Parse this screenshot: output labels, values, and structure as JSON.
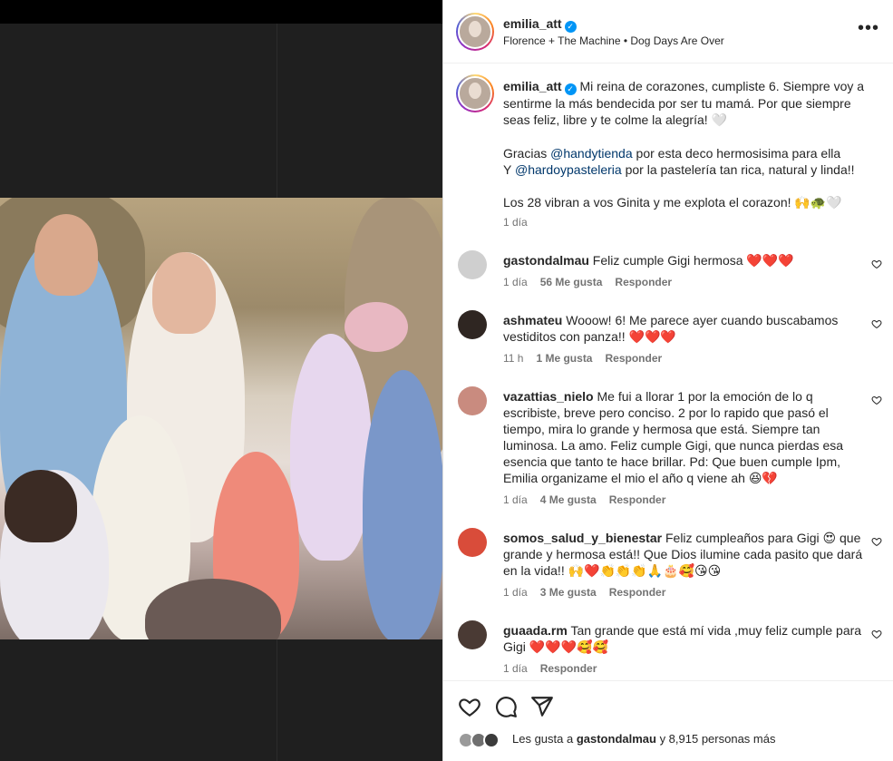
{
  "post": {
    "username": "emilia_att",
    "audio": "Florence + The Machine • Dog Days Are Over",
    "more_icon": "more-horizontal-icon"
  },
  "caption": {
    "username": "emilia_att",
    "line1": "Mi reina de corazones, cumpliste 6. Siempre voy a sentirme la más bendecida por ser tu mamá. Por que siempre seas feliz, libre y te colme la alegría! 🤍",
    "thanks_prefix": "Gracias ",
    "mention1": "@handytienda",
    "thanks_mid": " por esta deco hermosisima para ella",
    "and_prefix": "Y ",
    "mention2": "@hardoypasteleria",
    "and_suffix": " por la pastelería tan rica, natural y linda!!",
    "line3": "Los 28 vibran a vos Ginita y me explota el corazon! 🙌🐢🤍",
    "time": "1 día"
  },
  "comments": [
    {
      "username": "gastondalmau",
      "text": "Feliz cumple Gigi hermosa ❤️❤️❤️",
      "time": "1 día",
      "likes": "56 Me gusta",
      "reply": "Responder"
    },
    {
      "username": "ashmateu",
      "text": "Wooow! 6! Me parece ayer cuando buscabamos vestiditos con panza!! ❤️❤️❤️",
      "time": "11 h",
      "likes": "1 Me gusta",
      "reply": "Responder"
    },
    {
      "username": "vazattias_nielo",
      "text": "Me fui a llorar 1 por la emoción de lo q escribiste, breve pero conciso. 2 por lo rapido que pasó el tiempo, mira lo grande y hermosa que está. Siempre tan luminosa. La amo. Feliz cumple Gigi, que nunca pierdas esa esencia que tanto te hace brillar. Pd: Que buen cumple Ipm, Emilia organizame el mio el año q viene ah 😆💔",
      "time": "1 día",
      "likes": "4 Me gusta",
      "reply": "Responder"
    },
    {
      "username": "somos_salud_y_bienestar",
      "text": "Feliz cumpleaños para Gigi 😍 que grande y hermosa está!! Que Dios ilumine cada pasito que dará en la vida!! 🙌❤️👏👏👏🙏🎂🥰😘😘",
      "time": "1 día",
      "likes": "3 Me gusta",
      "reply": "Responder"
    },
    {
      "username": "guaada.rm",
      "text": "Tan grande que está mí vida ,muy feliz cumple para Gigi ❤️❤️❤️🥰🥰",
      "time": "1 día",
      "likes": "",
      "reply": "Responder"
    }
  ],
  "actions": {
    "like_icon": "heart-icon",
    "comment_icon": "comment-icon",
    "share_icon": "share-icon",
    "likes_prefix": "Les gusta a ",
    "likes_user": "gastondalmau",
    "likes_suffix": " y 8,915 personas más"
  }
}
